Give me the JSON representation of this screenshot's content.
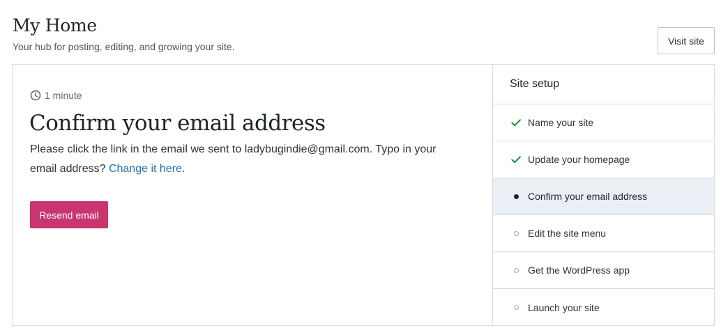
{
  "header": {
    "title": "My Home",
    "subtitle": "Your hub for posting, editing, and growing your site.",
    "visit_site_label": "Visit site"
  },
  "task": {
    "time": "1 minute",
    "title": "Confirm your email address",
    "desc_before": "Please click the link in the email we sent to ladybugindie@gmail.com. Typo in your email address? ",
    "change_link": "Change it here",
    "desc_after": ".",
    "resend_label": "Resend email"
  },
  "setup": {
    "title": "Site setup",
    "items": [
      {
        "label": "Name your site",
        "status": "done"
      },
      {
        "label": "Update your homepage",
        "status": "done"
      },
      {
        "label": "Confirm your email address",
        "status": "current"
      },
      {
        "label": "Edit the site menu",
        "status": "todo"
      },
      {
        "label": "Get the WordPress app",
        "status": "todo"
      },
      {
        "label": "Launch your site",
        "status": "todo"
      }
    ]
  },
  "colors": {
    "accent": "#c9356e",
    "link": "#2271b1",
    "check": "#008a20",
    "active_bg": "#e9eff5"
  },
  "icons": {
    "time": "clock-icon",
    "done": "checkmark-icon",
    "current": "filled-dot-icon",
    "todo": "empty-circle-icon"
  }
}
